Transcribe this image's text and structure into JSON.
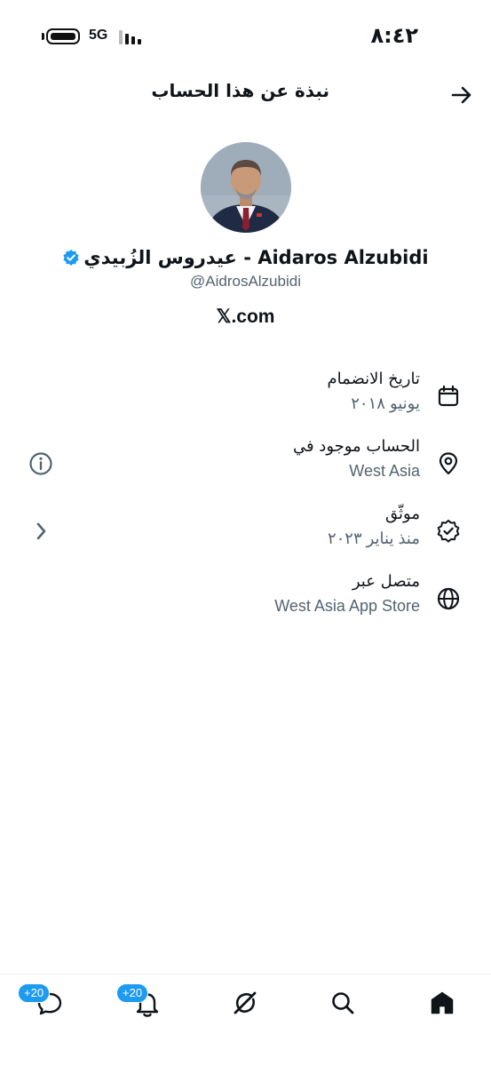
{
  "status_bar": {
    "time": "٨:٤٢",
    "network": "5G"
  },
  "header": {
    "title": "نبذة عن هذا الحساب"
  },
  "profile": {
    "display_name": "عيدروس الزُبيدي - Aidaros Alzubidi",
    "handle": "@AidrosAlzubidi",
    "website": "𝕏.com",
    "verified": true
  },
  "info": [
    {
      "title": "تاريخ الانضمام",
      "value": "يونيو ٢٠١٨",
      "icon": "calendar-icon"
    },
    {
      "title": "الحساب موجود في",
      "value": "West Asia",
      "icon": "location-pin-icon",
      "side_icon": "info-circle-icon"
    },
    {
      "title": "موثّق",
      "value": "منذ يناير ٢٠٢٣",
      "icon": "verified-badge-icon",
      "side_icon": "chevron-left-icon"
    },
    {
      "title": "متصل عبر",
      "value": "West Asia App Store",
      "icon": "globe-icon"
    }
  ],
  "bottom_nav": {
    "messages_badge": "+20",
    "notifications_badge": "+20",
    "items": [
      "messages-icon",
      "notifications-icon",
      "grok-icon",
      "search-icon",
      "home-icon"
    ]
  },
  "colors": {
    "accent": "#1d9bf0",
    "text": "#0f1419",
    "secondary_text": "#536471"
  }
}
